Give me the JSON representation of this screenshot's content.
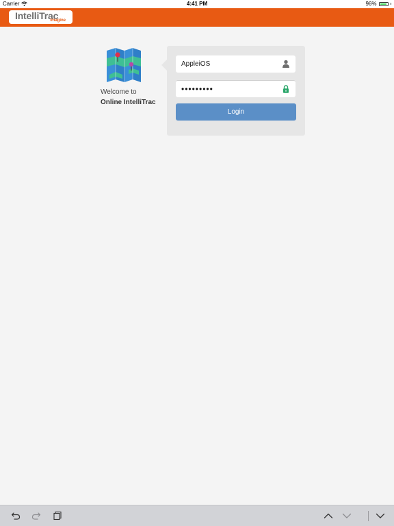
{
  "status_bar": {
    "carrier": "Carrier",
    "time": "4:41 PM",
    "battery_percent": "96%",
    "battery_level": 0.96
  },
  "header": {
    "logo_text": "IntelliTrac",
    "logo_subtext": "Imagine",
    "brand_color": "#e85a13"
  },
  "welcome": {
    "line1": "Welcome to",
    "line2": "Online IntelliTrac",
    "icon": "folded-map-icon"
  },
  "login": {
    "username_value": "AppleiOS",
    "username_icon": "user-icon",
    "password_value": "•••••••••",
    "password_icon": "lock-icon",
    "button_label": "Login",
    "button_color": "#5b8fc7"
  },
  "toolbar": {
    "undo_icon": "undo-icon",
    "redo_icon": "redo-icon",
    "paste_icon": "clipboard-icon",
    "prev_icon": "chevron-up-icon",
    "next_icon": "chevron-down-icon",
    "dismiss_icon": "keyboard-dismiss-icon"
  }
}
